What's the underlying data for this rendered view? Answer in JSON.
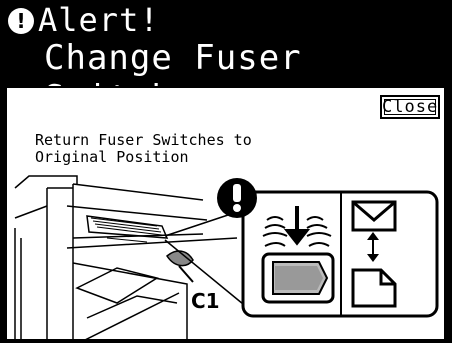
{
  "header": {
    "title": "Alert!",
    "subtitle": "Change Fuser Switches",
    "icon": "alert-exclamation-icon"
  },
  "panel": {
    "close_label": "Close",
    "instruction_line1": "Return Fuser Switches to",
    "instruction_line2": "Original Position"
  },
  "illustration": {
    "callout_label": "C1",
    "icons": [
      "printer-side-open-icon",
      "fuser-switch-icon",
      "down-arrow-icon",
      "envelope-icon",
      "paper-sheet-icon",
      "warning-exclamation-icon"
    ]
  }
}
